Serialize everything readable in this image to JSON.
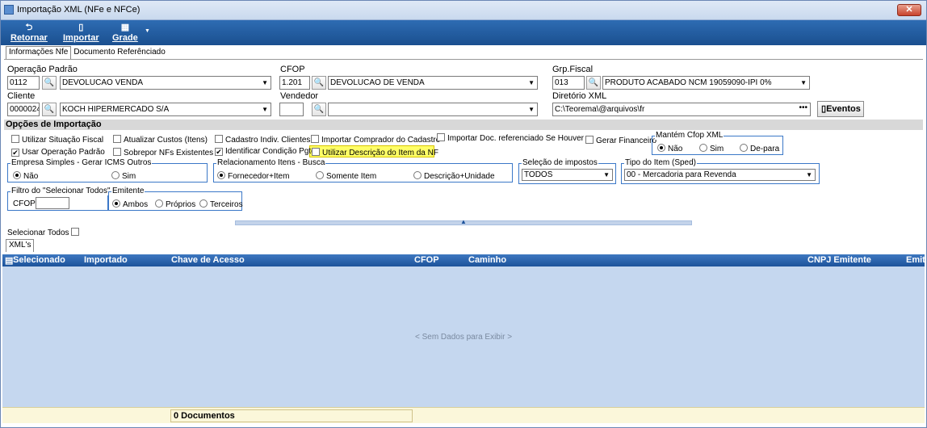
{
  "window": {
    "title": "Importação XML (NFe e NFCe)",
    "close": "✕"
  },
  "toolbar": {
    "retornar": "Retornar",
    "importar": "Importar",
    "grade": "Grade",
    "grade_caret": "▼"
  },
  "tabs": [
    "Informações Nfe",
    "Documento Referênciado"
  ],
  "fields": {
    "operacao_label": "Operação Padrão",
    "operacao_code": "0112",
    "operacao_value": "DEVOLUCAO VENDA",
    "cfop_label": "CFOP",
    "cfop_code": "1.201",
    "cfop_value": "DEVOLUCAO DE VENDA",
    "grp_label": "Grp.Fiscal",
    "grp_code": "013",
    "grp_value": "PRODUTO ACABADO NCM 19059090-IPI 0%",
    "cliente_label": "Cliente",
    "cliente_code": "0000024",
    "cliente_value": "KOCH HIPERMERCADO S/A",
    "vendedor_label": "Vendedor",
    "vendedor_code": "",
    "vendedor_value": "",
    "diretorio_label": "Diretório XML",
    "diretorio_value": "C:\\Teorema\\@arquivos\\fr",
    "diretorio_btn": "•••",
    "eventos": "Eventos"
  },
  "options_header": "Opções de Importação",
  "checks": {
    "utilizar_situacao": "Utilizar Situação Fiscal",
    "atualizar_custos": "Atualizar Custos (Itens)",
    "cadastro_indiv": "Cadastro Indiv. Clientes",
    "importar_comprador": "Importar Comprador do Cadastro",
    "importar_doc": "Importar Doc. referenciado Se Houver",
    "gerar_financeiro": "Gerar Financeiro",
    "usar_operacao": "Usar Operação Padrão",
    "sobrepor": "Sobrepor NFs Existentes",
    "identificar_cond": "Identificar Condição Pgto",
    "utilizar_desc": "Utilizar Descrição do Item da NF"
  },
  "mantem": {
    "title": "Mantém Cfop XML",
    "opts": [
      "Não",
      "Sim",
      "De-para"
    ]
  },
  "empresa": {
    "title": "Empresa Simples - Gerar ICMS Outros",
    "opts": [
      "Não",
      "Sim"
    ]
  },
  "relacionamento": {
    "title": "Relacionamento Itens - Busca",
    "opts": [
      "Fornecedor+Item",
      "Somente Item",
      "Descrição+Unidade"
    ]
  },
  "selecao": {
    "title": "Seleção de impostos",
    "value": "TODOS"
  },
  "tipo_item": {
    "title": "Tipo do Item (Sped)",
    "value": "00 - Mercadoria para Revenda"
  },
  "filtro": {
    "title": "Filtro do \"Selecionar Todos\"",
    "cfop_label": "CFOP"
  },
  "emitente": {
    "title": "Emitente",
    "opts": [
      "Ambos",
      "Próprios",
      "Terceiros"
    ]
  },
  "selecionar_todos": "Selecionar Todos",
  "xml_tab": "XML's",
  "grid": {
    "columns": [
      "Selecionado",
      "Importado",
      "Chave de Acesso",
      "CFOP",
      "Caminho",
      "CNPJ Emitente",
      "Emit"
    ],
    "empty": "< Sem Dados para Exibir >"
  },
  "footer": {
    "count": "0 Documentos"
  }
}
